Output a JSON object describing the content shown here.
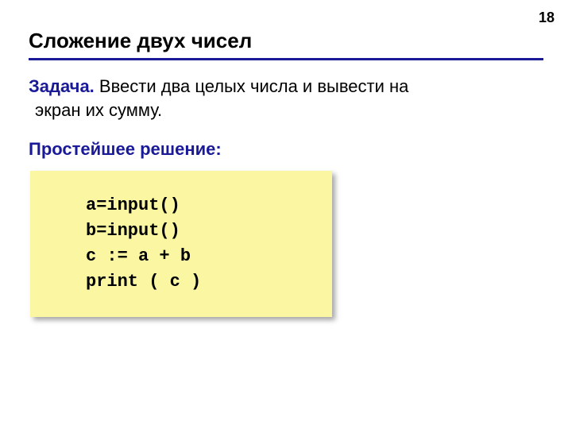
{
  "page_number": "18",
  "title": "Сложение двух чисел",
  "task": {
    "label": "Задача.",
    "text_rest_line1": " Ввести два целых числа и вывести на",
    "text_line2": "экран их сумму."
  },
  "solution_heading": "Простейшее решение:",
  "code": "a=input()\nb=input()\nc := a + b\nprint ( c )"
}
